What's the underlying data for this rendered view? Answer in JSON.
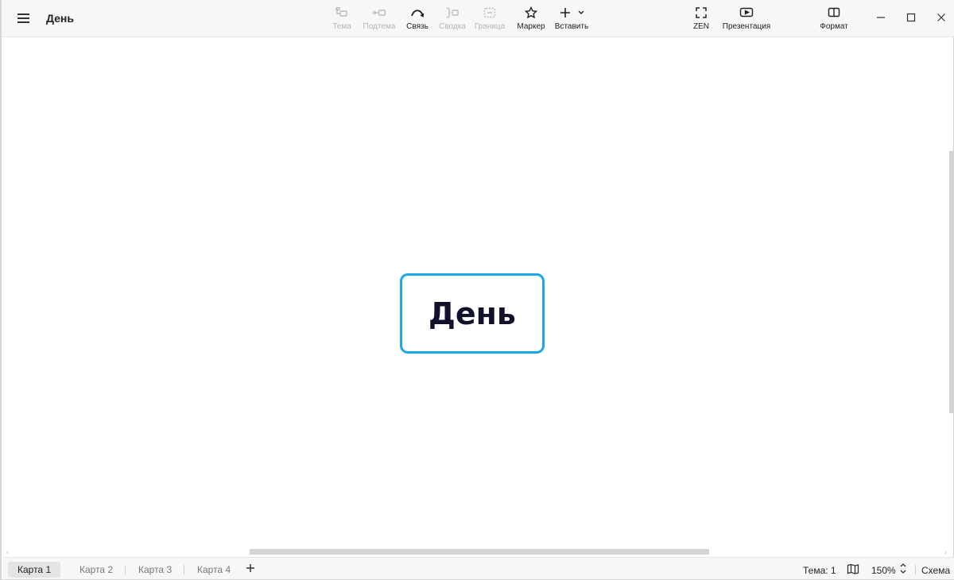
{
  "header": {
    "document_title": "День"
  },
  "toolbar": {
    "topic": "Тема",
    "subtopic": "Подтема",
    "relationship": "Связь",
    "summary": "Сводка",
    "boundary": "Граница",
    "marker": "Маркер",
    "insert": "Вставить",
    "zen": "ZEN",
    "presentation": "Презентация",
    "format": "Формат"
  },
  "canvas": {
    "central_topic": "День",
    "topic_border_color": "#1ca7e6"
  },
  "sheets": {
    "tabs": [
      "Карта 1",
      "Карта 2",
      "Карта 3",
      "Карта 4"
    ],
    "active_index": 0
  },
  "status": {
    "theme": "Тема: 1",
    "zoom": "150%",
    "outline": "Схема"
  },
  "icons": [
    "menu-icon",
    "topic-icon",
    "subtopic-icon",
    "relationship-icon",
    "summary-icon",
    "boundary-icon",
    "star-icon",
    "plus-icon",
    "chevron-down-icon",
    "fullscreen-icon",
    "presentation-icon",
    "format-panel-icon",
    "minimize-icon",
    "maximize-icon",
    "close-icon",
    "map-icon",
    "zoom-stepper-icon"
  ]
}
